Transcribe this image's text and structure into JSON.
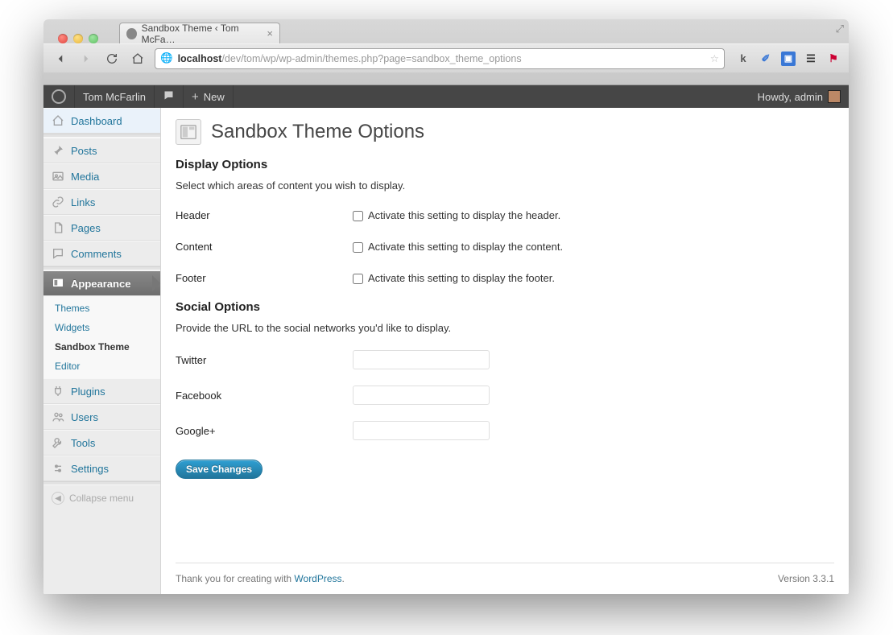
{
  "browser": {
    "tab_title": "Sandbox Theme ‹ Tom McFa…",
    "url_prefix": "localhost",
    "url_rest": "/dev/tom/wp/wp-admin/themes.php?page=sandbox_theme_options"
  },
  "adminbar": {
    "site_name": "Tom McFarlin",
    "new_label": "New",
    "howdy": "Howdy, admin"
  },
  "menu": {
    "dashboard": "Dashboard",
    "posts": "Posts",
    "media": "Media",
    "links": "Links",
    "pages": "Pages",
    "comments": "Comments",
    "appearance": "Appearance",
    "appearance_sub": {
      "themes": "Themes",
      "widgets": "Widgets",
      "sandbox_theme": "Sandbox Theme",
      "editor": "Editor"
    },
    "plugins": "Plugins",
    "users": "Users",
    "tools": "Tools",
    "settings": "Settings",
    "collapse": "Collapse menu"
  },
  "page": {
    "title": "Sandbox Theme Options",
    "display_section": "Display Options",
    "display_desc": "Select which areas of content you wish to display.",
    "rows": {
      "header": {
        "label": "Header",
        "desc": "Activate this setting to display the header."
      },
      "content": {
        "label": "Content",
        "desc": "Activate this setting to display the content."
      },
      "footer": {
        "label": "Footer",
        "desc": "Activate this setting to display the footer."
      }
    },
    "social_section": "Social Options",
    "social_desc": "Provide the URL to the social networks you'd like to display.",
    "social": {
      "twitter": "Twitter",
      "facebook": "Facebook",
      "googleplus": "Google+"
    },
    "save": "Save Changes"
  },
  "footer": {
    "thanks_pre": "Thank you for creating with ",
    "thanks_link": "WordPress",
    "thanks_post": ".",
    "version": "Version 3.3.1"
  }
}
